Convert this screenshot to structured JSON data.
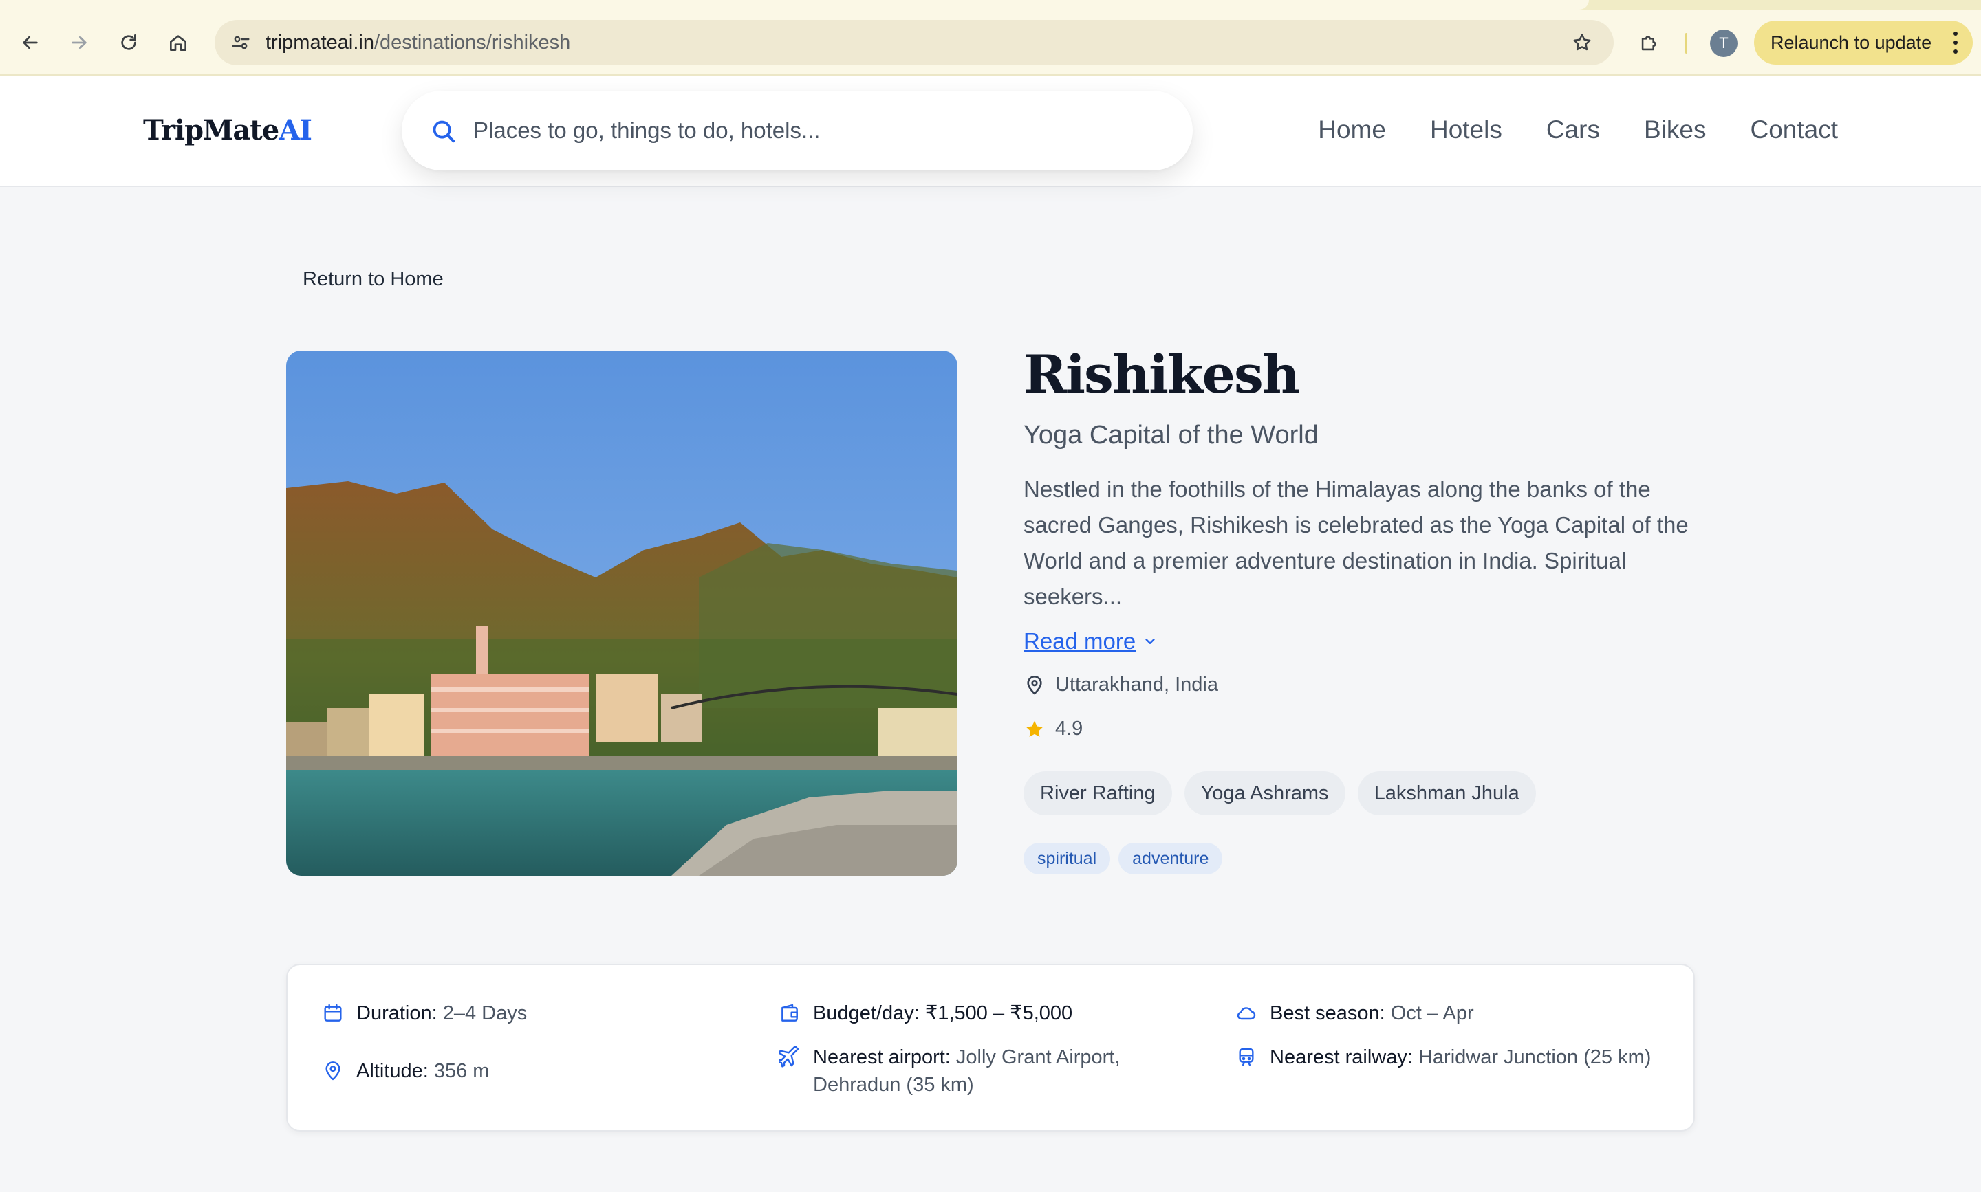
{
  "browser": {
    "url_host": "tripmateai.in",
    "url_path": "/destinations/rishikesh",
    "avatar_letter": "T",
    "relaunch_label": "Relaunch to update"
  },
  "site": {
    "logo_main": "TripMate",
    "logo_accent": "AI",
    "accent_color": "#2563eb",
    "search_placeholder": "Places to go, things to do, hotels...",
    "nav": [
      "Home",
      "Hotels",
      "Cars",
      "Bikes",
      "Contact"
    ]
  },
  "page": {
    "return_label": "Return to Home",
    "title": "Rishikesh",
    "subtitle": "Yoga Capital of the World",
    "description": "Nestled in the foothills of the Himalayas along the banks of the sacred Ganges, Rishikesh is celebrated as the Yoga Capital of the World and a premier adventure destination in India. Spiritual seekers...",
    "read_more": "Read more",
    "location": "Uttarakhand, India",
    "rating": "4.9",
    "highlights": [
      "River Rafting",
      "Yoga Ashrams",
      "Lakshman Jhula"
    ],
    "tags": [
      "spiritual",
      "adventure"
    ]
  },
  "info": {
    "duration_label": "Duration:",
    "duration_value": "2–4 Days",
    "budget_label": "Budget/day:",
    "budget_value": "₹1,500 – ₹5,000",
    "season_label": "Best season:",
    "season_value": "Oct – Apr",
    "altitude_label": "Altitude:",
    "altitude_value": "356 m",
    "airport_label": "Nearest airport:",
    "airport_value": "Jolly Grant Airport, Dehradun (35 km)",
    "railway_label": "Nearest railway:",
    "railway_value": "Haridwar Junction (25 km)"
  }
}
